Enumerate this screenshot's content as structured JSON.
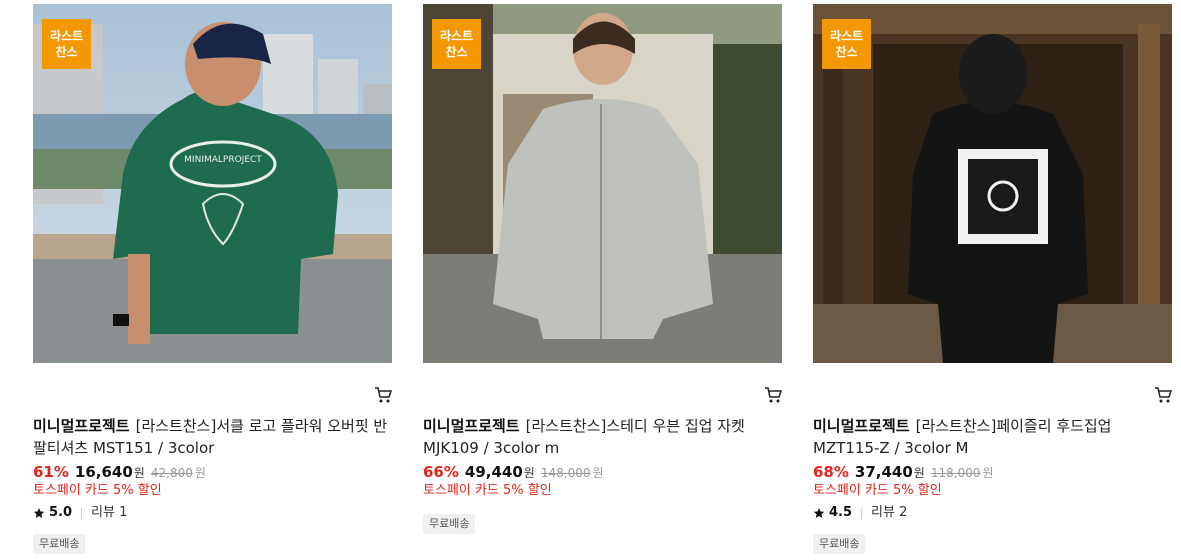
{
  "products": [
    {
      "badge": [
        "라스트",
        "찬스"
      ],
      "brand": "미니멀프로젝트",
      "name": "[라스트찬스]서클 로고 플라워 오버핏 반팔티셔츠 MST151 / 3color",
      "discount": "61%",
      "price": "16,640",
      "won": "원",
      "original_price": "42,800",
      "original_won": "원",
      "promo": "토스페이 카드 5% 할인",
      "rating": "5.0",
      "reviews": "리뷰 1",
      "tag": "무료배송",
      "image": "man in green graphic t-shirt, back view, city river background"
    },
    {
      "badge": [
        "라스트",
        "찬스"
      ],
      "brand": "미니멀프로젝트",
      "name": "[라스트찬스]스테디 우븐 집업 자켓 MJK109 / 3color m",
      "discount": "66%",
      "price": "49,440",
      "won": "원",
      "original_price": "148,000",
      "original_won": "원",
      "promo": "토스페이 카드 5% 할인",
      "tag": "무료배송",
      "image": "man in light grey zip-up jacket, street background"
    },
    {
      "badge": [
        "라스트",
        "찬스"
      ],
      "brand": "미니멀프로젝트",
      "name": "[라스트찬스]페이즐리 후드집업 MZT115-Z / 3color M",
      "discount": "68%",
      "price": "37,440",
      "won": "원",
      "original_price": "118,000",
      "original_won": "원",
      "promo": "토스페이 카드 5% 할인",
      "rating": "4.5",
      "reviews": "리뷰 2",
      "tag": "무료배송",
      "image": "man in black hoodie with paisley back print, wooden hut background"
    }
  ],
  "icons": {
    "cart": "cart-icon",
    "star": "star-icon"
  },
  "colors": {
    "badge": "#f39800",
    "discount": "#e1261c",
    "promo": "#e1261c"
  }
}
